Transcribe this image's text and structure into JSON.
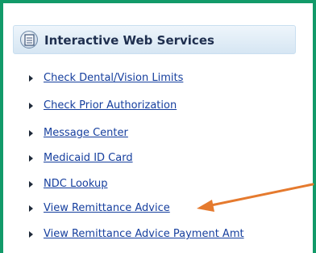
{
  "panel": {
    "title": "Interactive Web Services",
    "icon": "document-icon"
  },
  "links": [
    {
      "label": "Check Dental/Vision Limits"
    },
    {
      "label": "Check Prior Authorization"
    },
    {
      "label": "Message Center"
    },
    {
      "label": "Medicaid ID Card"
    },
    {
      "label": "NDC Lookup"
    },
    {
      "label": "View Remittance Advice"
    },
    {
      "label": "View Remittance Advice Payment Amt"
    }
  ],
  "annotation": {
    "arrow_color": "#e57a2e",
    "points_to": "View Remittance Advice"
  },
  "colors": {
    "frame_border": "#129a69",
    "link": "#163f9e",
    "header_bg": "#dbe8f4"
  }
}
